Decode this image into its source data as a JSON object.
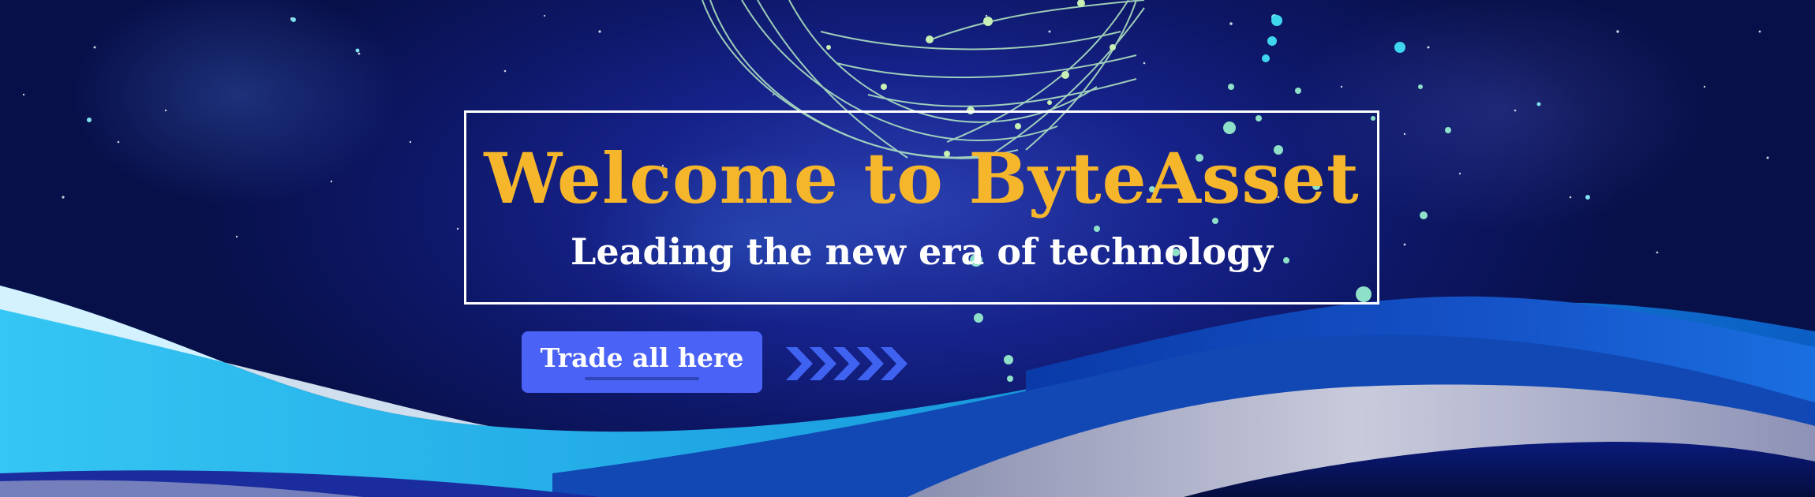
{
  "hero": {
    "title": "Welcome to ByteAsset",
    "subtitle": "Leading the new era of technology",
    "cta_label": "Trade all here"
  },
  "colors": {
    "background": "#0d1766",
    "title": "#f6b62c",
    "subtitle": "#ffffff",
    "button": "#4a62f5",
    "arrows": "#3f63f0",
    "wave_cyan": "#1ba9e6",
    "wave_blue": "#1046b8",
    "wave_silver": "#b9bcd2"
  },
  "icons": {
    "arrows": "chevrons-right-icon",
    "globe": "network-globe-icon"
  }
}
